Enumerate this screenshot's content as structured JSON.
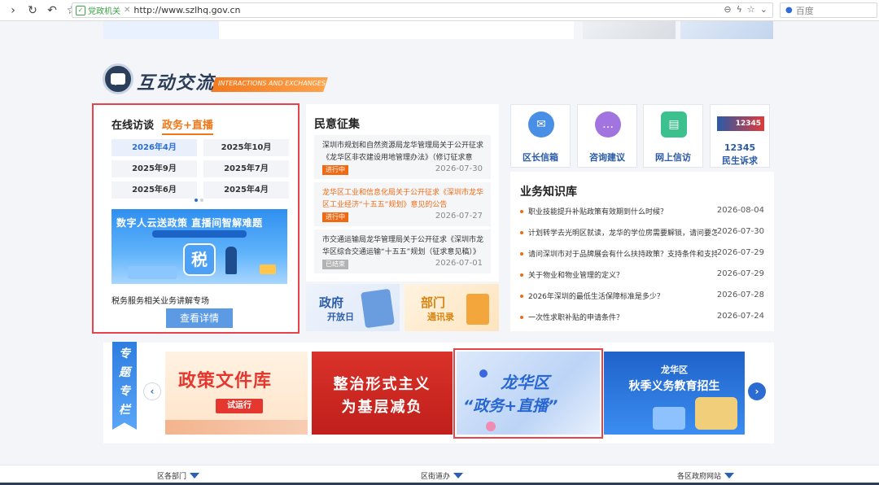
{
  "browser": {
    "gov_tag": "党政机关",
    "url": "http://www.szlhq.gov.cn",
    "search_placeholder": "百度"
  },
  "section": {
    "title": "互动交流",
    "subtitle": "INTERACTIONS AND EXCHANGES"
  },
  "interview": {
    "tab_online": "在线访谈",
    "tab_live": "政务+直播",
    "dates": [
      "2026年4月",
      "2025年10月",
      "2025年9月",
      "2025年7月",
      "2025年6月",
      "2025年4月"
    ],
    "banner_title": "数字人云送政策 直播间智解难题",
    "banner_symbol": "税",
    "caption": "税务服务相关业务讲解专场",
    "detail_button": "查看详情"
  },
  "solicitation": {
    "title": "民意征集",
    "items": [
      {
        "text": "深圳市规划和自然资源局龙华管理局关于公开征求《龙华区非农建设用地管理办法》（修订征求意见...",
        "status": "进行中",
        "date": "2026-07-30"
      },
      {
        "text": "龙华区工业和信息化局关于公开征求《深圳市龙华区工业经济“十五五”规划》意见的公告",
        "status": "进行中",
        "date": "2026-07-27"
      },
      {
        "text": "市交通运输局龙华管理局关于公开征求《深圳市龙华区综合交通运输“十五五”规划（征求意见稿）》意...",
        "status": "已结束",
        "date": "2026-07-01"
      }
    ]
  },
  "mini_cards": {
    "gov_open_a": "政府",
    "gov_open_b": "开放日",
    "dept_a": "部门",
    "dept_b": "通讯录"
  },
  "tiles": {
    "mailbox": "区长信箱",
    "consult": "咨询建议",
    "petition": "网上信访",
    "hotline_logo": "12345",
    "hotline_num": "12345",
    "hotline_label": "民生诉求"
  },
  "knowledge": {
    "title": "业务知识库",
    "rows": [
      {
        "q": "职业技能提升补贴政策有效期到什么时候？",
        "d": "2026-08-04"
      },
      {
        "q": "计划转学去光明区就读，龙华的学位房需要解锁，请问要怎...",
        "d": "2026-07-30"
      },
      {
        "q": "请问深圳市对于品牌展会有什么扶持政策？支持条件和支持...",
        "d": "2026-07-29"
      },
      {
        "q": "关于物业和物业管理的定义？",
        "d": "2026-07-29"
      },
      {
        "q": "2026年深圳的最低生活保障标准是多少？",
        "d": "2026-07-28"
      },
      {
        "q": "一次性求职补贴的申请条件？",
        "d": "2026-07-24"
      }
    ]
  },
  "topics": {
    "label": [
      "专",
      "题",
      "专",
      "栏"
    ],
    "card1_title": "政策文件库",
    "card1_badge": "试运行",
    "card2_l1": "整治形式主义",
    "card2_l2": "为基层减负",
    "card3_l1": "龙华区",
    "card3_l2": "“政务+直播”",
    "card4_l1": "龙华区",
    "card4_l2": "秋季义务教育招生"
  },
  "footer": {
    "dept": "区各部门",
    "street": "区街道办",
    "districts": "各区政府网站"
  },
  "colors": {
    "accent_orange": "#f17717",
    "highlight_red": "#e7434c",
    "brand_blue": "#2a6fd0"
  }
}
